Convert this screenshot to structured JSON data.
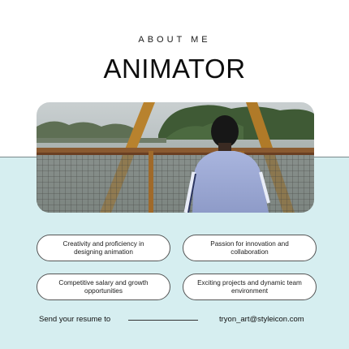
{
  "header": {
    "eyebrow": "ABOUT ME",
    "title": "ANIMATOR"
  },
  "photo": {
    "description": "person-at-bridge-railing"
  },
  "highlights": [
    {
      "text": "Creativity and proficiency in designing animation"
    },
    {
      "text": "Passion for innovation and collaboration"
    },
    {
      "text": "Competitive salary and growth opportunities"
    },
    {
      "text": "Exciting projects and dynamic team environment"
    }
  ],
  "footer": {
    "cta": "Send your resume to",
    "email": "tryon_art@styleicon.com"
  },
  "colors": {
    "top_background": "#ffffff",
    "bottom_background": "#d6eef0",
    "pill_background": "#ffffff",
    "text": "#111111"
  }
}
